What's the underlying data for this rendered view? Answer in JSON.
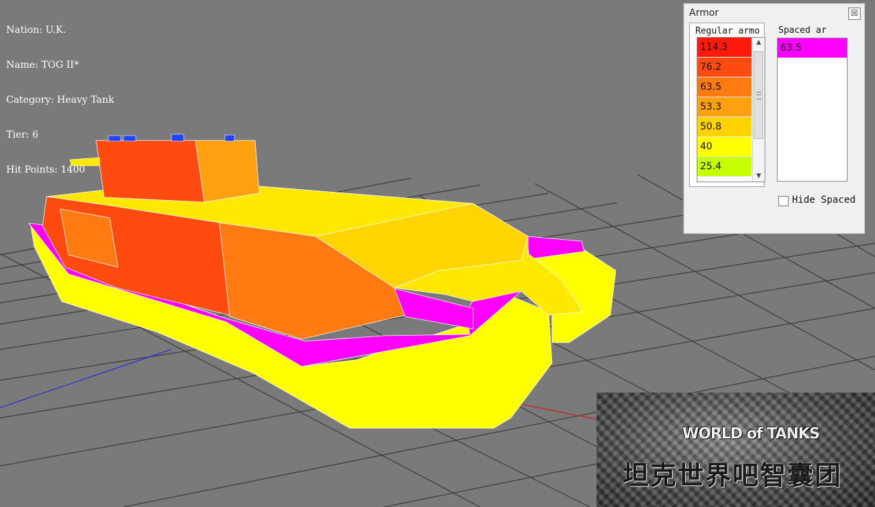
{
  "tank_info": {
    "nation": "Nation: U.K.",
    "name": "Name: TOG II*",
    "category": "Category: Heavy Tank",
    "tier": "Tier: 6",
    "hit_points": "Hit Points: 1400"
  },
  "armor_window": {
    "title": "Armor",
    "close_glyph": "☒",
    "regular_header": "Regular armo",
    "spaced_header": "Spaced ar",
    "regular_values": [
      {
        "value": "114.3",
        "color": "#ff1a0d"
      },
      {
        "value": "76.2",
        "color": "#ff4a10"
      },
      {
        "value": "63.5",
        "color": "#ff7a10"
      },
      {
        "value": "53.3",
        "color": "#ffa010"
      },
      {
        "value": "50.8",
        "color": "#ffd200"
      },
      {
        "value": "40",
        "color": "#ffff00"
      },
      {
        "value": "25.4",
        "color": "#c8ff00"
      }
    ],
    "spaced_values": [
      {
        "value": "63.5",
        "color": "#ff00ff"
      }
    ],
    "hide_spaced_label": "Hide Spaced A",
    "hide_spaced_checked": false
  },
  "watermark": {
    "logo": "WORLD of TANKS",
    "text": "坦克世界吧智囊团"
  },
  "colors": {
    "background": "#7a7a7a",
    "yellow": "#ffff00",
    "magenta": "#ff00ff",
    "red": "#ff4a10",
    "orange": "#ff7a10"
  }
}
